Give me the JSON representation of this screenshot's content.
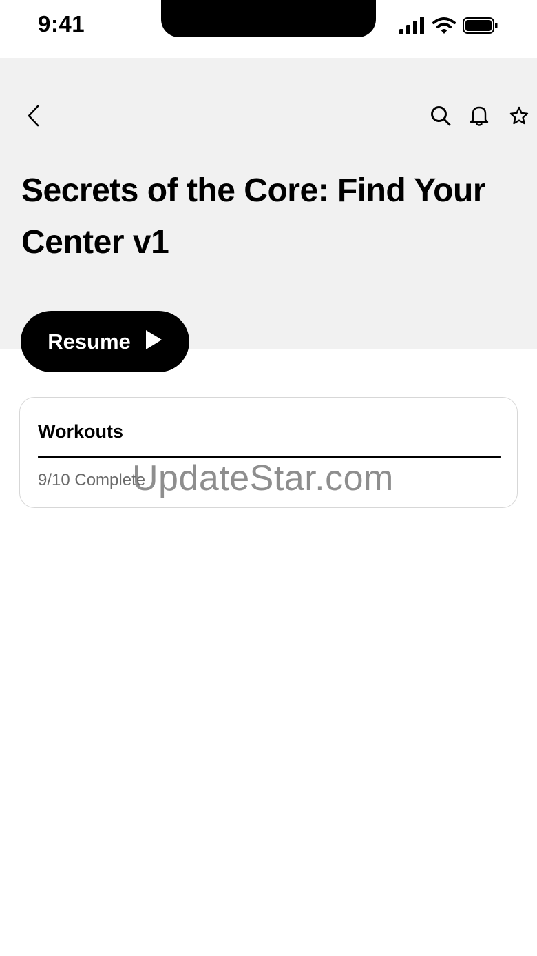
{
  "status_bar": {
    "time": "9:41",
    "icons": [
      "signal-icon",
      "wifi-icon",
      "battery-icon"
    ]
  },
  "header": {
    "title": "Secrets of the Core: Find Your Center v1",
    "icons": [
      "back-chevron-icon",
      "search-icon",
      "bell-icon",
      "star-icon"
    ]
  },
  "resume": {
    "label": "Resume",
    "icon": "play-icon"
  },
  "workouts": {
    "title": "Workouts",
    "progress_text": "9/10 Complete",
    "completed": 9,
    "total": 10,
    "progress_fraction": 1.0
  },
  "watermark": "UpdateStar.com",
  "colors": {
    "header_bg": "#f1f1f1",
    "button_bg": "#000000",
    "button_text": "#ffffff",
    "progress": "#000000"
  }
}
